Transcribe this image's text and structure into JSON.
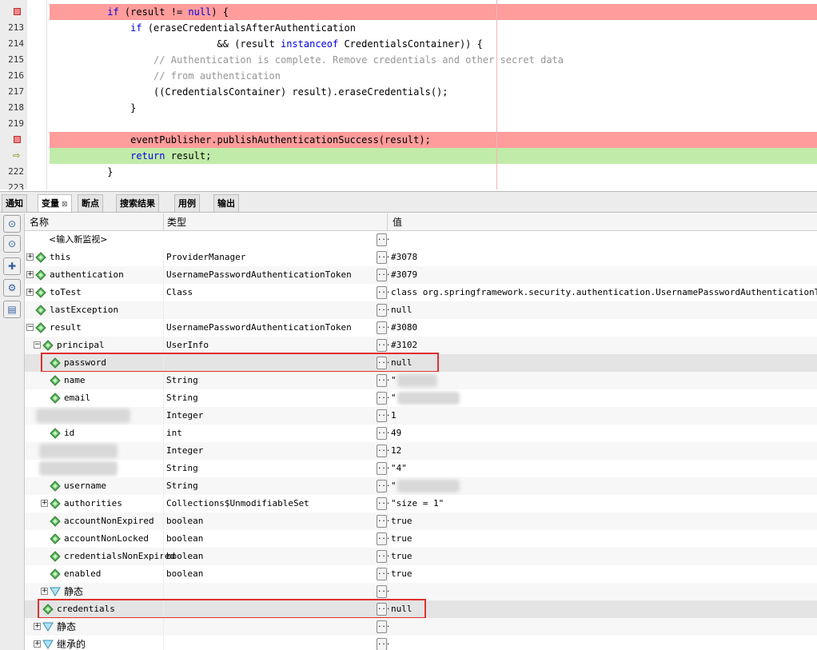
{
  "editor": {
    "lines": [
      {
        "num": "",
        "marker": "breakpoint",
        "bg": "red",
        "parts": [
          [
            "",
            "          "
          ],
          [
            "kw",
            "if"
          ],
          [
            "",
            " (result != "
          ],
          [
            "kw",
            "null"
          ],
          [
            "",
            ") {"
          ]
        ]
      },
      {
        "num": "213",
        "marker": "",
        "bg": "",
        "parts": [
          [
            "",
            "              "
          ],
          [
            "kw",
            "if"
          ],
          [
            "",
            " (eraseCredentialsAfterAuthentication"
          ]
        ]
      },
      {
        "num": "214",
        "marker": "",
        "bg": "",
        "parts": [
          [
            "",
            "                             && (result "
          ],
          [
            "kw",
            "instanceof"
          ],
          [
            "",
            " CredentialsContainer)) {"
          ]
        ]
      },
      {
        "num": "215",
        "marker": "",
        "bg": "",
        "parts": [
          [
            "",
            "                  "
          ],
          [
            "cm",
            "// Authentication is complete. Remove credentials and other secret data"
          ]
        ]
      },
      {
        "num": "216",
        "marker": "",
        "bg": "",
        "parts": [
          [
            "",
            "                  "
          ],
          [
            "cm",
            "// from authentication"
          ]
        ]
      },
      {
        "num": "217",
        "marker": "",
        "bg": "",
        "parts": [
          [
            "",
            "                  ((CredentialsContainer) result).eraseCredentials();"
          ]
        ]
      },
      {
        "num": "218",
        "marker": "",
        "bg": "",
        "parts": [
          [
            "",
            "              }"
          ]
        ]
      },
      {
        "num": "219",
        "marker": "",
        "bg": "",
        "parts": [
          [
            "",
            ""
          ]
        ]
      },
      {
        "num": "",
        "marker": "breakpoint",
        "bg": "red",
        "parts": [
          [
            "",
            "              eventPublisher.publishAuthenticationSuccess(result);"
          ]
        ]
      },
      {
        "num": "",
        "marker": "pc",
        "bg": "green",
        "parts": [
          [
            "",
            "              "
          ],
          [
            "kw",
            "return"
          ],
          [
            "",
            " result;"
          ]
        ]
      },
      {
        "num": "222",
        "marker": "",
        "bg": "",
        "parts": [
          [
            "",
            "          }"
          ]
        ]
      },
      {
        "num": "223",
        "marker": "",
        "bg": "",
        "parts": [
          [
            "",
            ""
          ]
        ]
      }
    ]
  },
  "tabs": [
    {
      "label": "通知",
      "active": false
    },
    {
      "label": "变量",
      "active": true,
      "close": "⊠"
    },
    {
      "label": "断点",
      "active": false
    },
    {
      "label": "搜索结果",
      "active": false
    },
    {
      "label": "用例",
      "active": false
    },
    {
      "label": "输出",
      "active": false
    }
  ],
  "toolbar": {
    "buttons": [
      "watch-icon",
      "watch-icon",
      "add-watch-icon",
      "settings-icon",
      "table-icon"
    ]
  },
  "table": {
    "headers": {
      "name": "名称",
      "type": "类型",
      "value": "值"
    },
    "watch_placeholder": "<输入新监视>",
    "rows": [
      {
        "indent": 0,
        "expander": "+",
        "icon": "diamond",
        "name": "this",
        "type": "ProviderManager",
        "value": "#3078"
      },
      {
        "indent": 0,
        "expander": "+",
        "icon": "diamond",
        "name": "authentication",
        "type": "UsernamePasswordAuthenticationToken",
        "value": "#3079"
      },
      {
        "indent": 0,
        "expander": "+",
        "icon": "diamond",
        "name": "toTest",
        "type": "Class",
        "value": "class org.springframework.security.authentication.UsernamePasswordAuthenticationToken"
      },
      {
        "indent": 0,
        "expander": "",
        "icon": "diamond",
        "name": "lastException",
        "type": "",
        "value": "null"
      },
      {
        "indent": 0,
        "expander": "-",
        "icon": "diamond",
        "name": "result",
        "type": "UsernamePasswordAuthenticationToken",
        "value": "#3080"
      },
      {
        "indent": 1,
        "expander": "-",
        "icon": "diamond",
        "name": "principal",
        "type": "UserInfo",
        "value": "#3102"
      },
      {
        "indent": 2,
        "expander": "",
        "icon": "diamond",
        "name": "password",
        "type": "",
        "value": "null",
        "highlight": true
      },
      {
        "indent": 2,
        "expander": "",
        "icon": "diamond",
        "name": "name",
        "type": "String",
        "value": "\"",
        "blurred": true
      },
      {
        "indent": 2,
        "expander": "",
        "icon": "diamond",
        "name": "email",
        "type": "String",
        "value": "\"",
        "blurred": true
      },
      {
        "indent": 2,
        "expander": "",
        "icon": "",
        "name": "",
        "type": "Integer",
        "value": "1",
        "blurred_name": true
      },
      {
        "indent": 2,
        "expander": "",
        "icon": "diamond",
        "name": "id",
        "type": "int",
        "value": "49"
      },
      {
        "indent": 2,
        "expander": "",
        "icon": "",
        "name": "",
        "type": "Integer",
        "value": "12",
        "blurred_name": true
      },
      {
        "indent": 2,
        "expander": "",
        "icon": "",
        "name": "",
        "type": "String",
        "value": "\"4\"",
        "blurred_name": true
      },
      {
        "indent": 2,
        "expander": "",
        "icon": "diamond",
        "name": "username",
        "type": "String",
        "value": "\"",
        "blurred": true
      },
      {
        "indent": 2,
        "expander": "+",
        "icon": "diamond",
        "name": "authorities",
        "type": "Collections$UnmodifiableSet",
        "value": "\"size = 1\""
      },
      {
        "indent": 2,
        "expander": "",
        "icon": "diamond",
        "name": "accountNonExpired",
        "type": "boolean",
        "value": "true"
      },
      {
        "indent": 2,
        "expander": "",
        "icon": "diamond",
        "name": "accountNonLocked",
        "type": "boolean",
        "value": "true"
      },
      {
        "indent": 2,
        "expander": "",
        "icon": "diamond",
        "name": "credentialsNonExpired",
        "type": "boolean",
        "value": "true"
      },
      {
        "indent": 2,
        "expander": "",
        "icon": "diamond",
        "name": "enabled",
        "type": "boolean",
        "value": "true"
      },
      {
        "indent": 2,
        "expander": "+",
        "icon": "triangle",
        "name": "静态",
        "type": "",
        "value": ""
      },
      {
        "indent": 1,
        "expander": "",
        "icon": "diamond",
        "name": "credentials",
        "type": "",
        "value": "null",
        "highlight": true
      },
      {
        "indent": 1,
        "expander": "+",
        "icon": "triangle",
        "name": "静态",
        "type": "",
        "value": ""
      },
      {
        "indent": 1,
        "expander": "+",
        "icon": "triangle",
        "name": "继承的",
        "type": "",
        "value": ""
      }
    ]
  },
  "colors": {
    "breakpoint_line": "#ff9c9c",
    "current_line": "#c1eba8",
    "keyword": "#0000e6",
    "comment": "#969696",
    "highlight_border": "#e03030",
    "field_icon": "#3a9a3a"
  }
}
